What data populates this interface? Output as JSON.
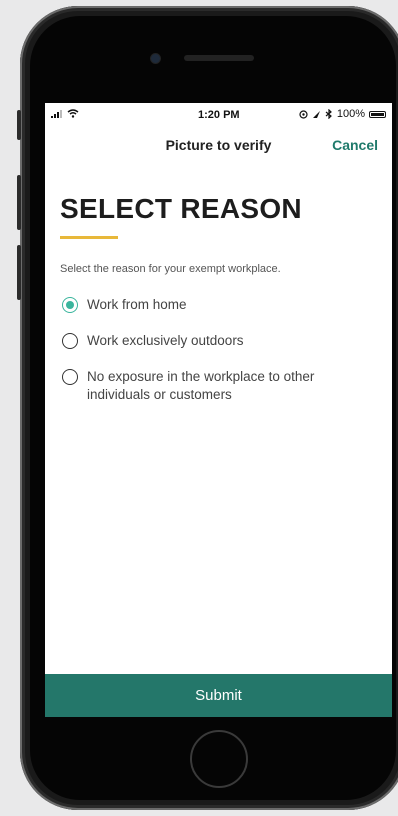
{
  "status_bar": {
    "time": "1:20 PM",
    "battery": "100%"
  },
  "nav": {
    "title": "Picture to verify",
    "cancel_label": "Cancel"
  },
  "page": {
    "heading": "SELECT REASON",
    "instructions": "Select the reason for your exempt workplace."
  },
  "reasons": {
    "selected_index": 0,
    "options": [
      {
        "label": "Work from home",
        "selected": true
      },
      {
        "label": "Work exclusively outdoors",
        "selected": false
      },
      {
        "label": "No exposure in the workplace to other individuals or customers",
        "selected": false
      }
    ]
  },
  "actions": {
    "submit_label": "Submit"
  },
  "colors": {
    "accent_teal": "#24776a",
    "radio_selected": "#3ab59d",
    "underline_gold": "#e8b83a",
    "cancel_text": "#1f7a6b"
  },
  "icons": [
    "signal-icon",
    "wifi-icon",
    "location-icon",
    "alarm-icon",
    "bluetooth-icon",
    "battery-icon"
  ]
}
